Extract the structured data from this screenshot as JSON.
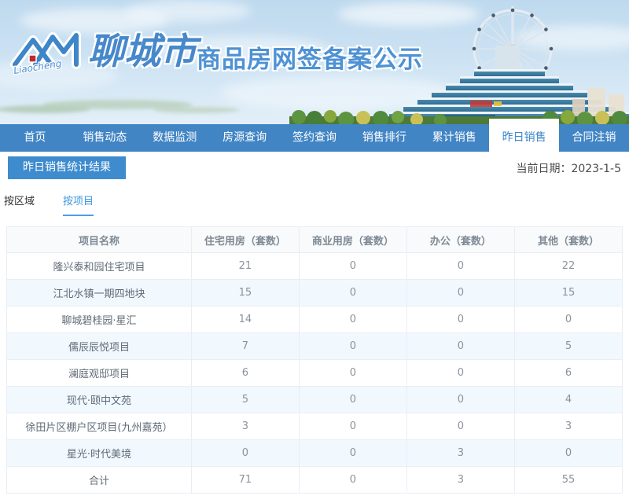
{
  "header": {
    "logo_script": "Liaocheng",
    "site_name": "聊城市",
    "site_title": "商品房网签备案公示"
  },
  "nav": {
    "items": [
      {
        "label": "首页",
        "active": false
      },
      {
        "label": "销售动态",
        "active": false
      },
      {
        "label": "数据监测",
        "active": false
      },
      {
        "label": "房源查询",
        "active": false
      },
      {
        "label": "签约查询",
        "active": false
      },
      {
        "label": "销售排行",
        "active": false
      },
      {
        "label": "累计销售",
        "active": false
      },
      {
        "label": "昨日销售",
        "active": true
      },
      {
        "label": "合同注销",
        "active": false
      }
    ]
  },
  "page": {
    "section_title": "昨日销售统计结果",
    "current_date_label": "当前日期：2023-1-5",
    "tabs": [
      {
        "label": "按区域",
        "active": false
      },
      {
        "label": "按项目",
        "active": true
      }
    ]
  },
  "table": {
    "columns": [
      "项目名称",
      "住宅用房（套数）",
      "商业用房（套数）",
      "办公（套数）",
      "其他（套数）"
    ],
    "rows": [
      [
        "隆兴泰和园住宅项目",
        "21",
        "0",
        "0",
        "22"
      ],
      [
        "江北水镇一期四地块",
        "15",
        "0",
        "0",
        "15"
      ],
      [
        "聊城碧桂园·星汇",
        "14",
        "0",
        "0",
        "0"
      ],
      [
        "儒辰辰悦项目",
        "7",
        "0",
        "0",
        "5"
      ],
      [
        "澜庭观邸项目",
        "6",
        "0",
        "0",
        "6"
      ],
      [
        "现代·颐中文苑",
        "5",
        "0",
        "0",
        "4"
      ],
      [
        "徐田片区棚户区项目(九州嘉苑）",
        "3",
        "0",
        "0",
        "3"
      ],
      [
        "星光·时代美境",
        "0",
        "0",
        "3",
        "0"
      ],
      [
        "合计",
        "71",
        "0",
        "3",
        "55"
      ]
    ]
  },
  "colors": {
    "nav_blue": "#4285c4",
    "badge_blue": "#3e8bce",
    "active_tab_blue": "#3e97e0",
    "brand_blue": "#4788cb",
    "logo_red": "#c2272d",
    "row_alt": "#f1f8fe",
    "table_border": "#e9eef5"
  }
}
